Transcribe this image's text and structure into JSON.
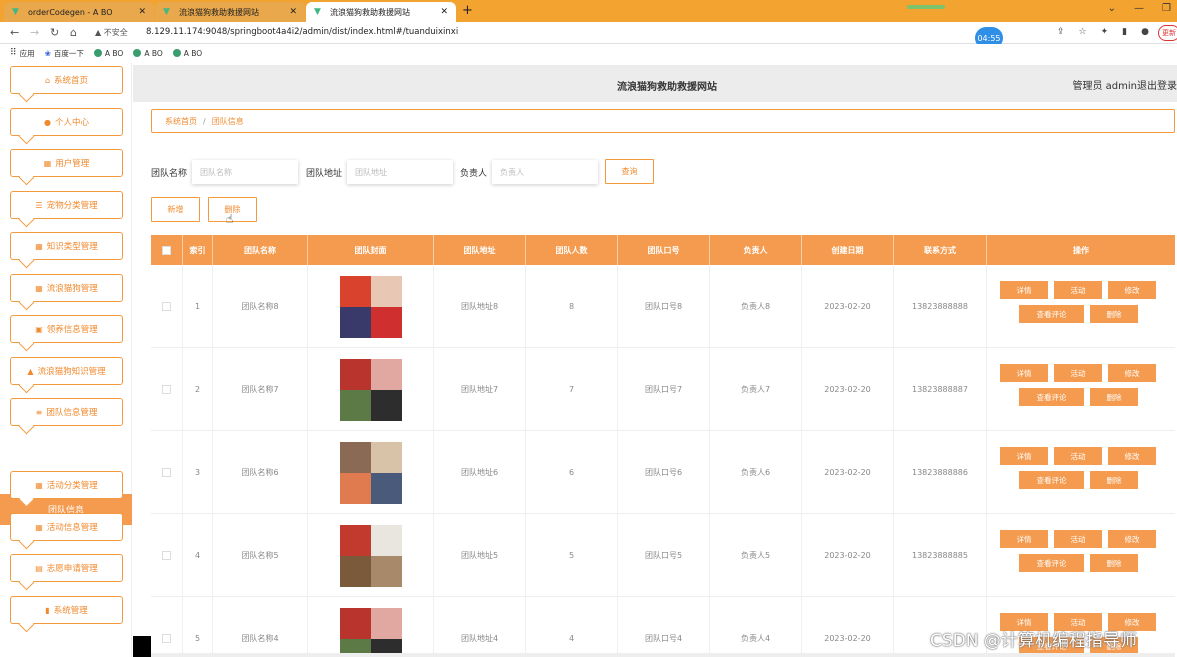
{
  "browser": {
    "tabs": [
      {
        "title": "orderCodegen - A BO"
      },
      {
        "title": "流浪猫狗救助救援网站"
      },
      {
        "title": "流浪猫狗救助救援网站"
      }
    ],
    "address": {
      "security": "不安全",
      "url": "8.129.11.174:9048/springboot4a4i2/admin/dist/index.html#/tuanduixinxi"
    },
    "timer": "04:55",
    "update_label": "更新",
    "bookmarks": [
      {
        "label": "应用",
        "icon": "apps-icon"
      },
      {
        "label": "百度一下",
        "icon": "baidu-icon"
      },
      {
        "label": "A BO",
        "icon": "site-icon"
      },
      {
        "label": "A BO",
        "icon": "site-icon"
      },
      {
        "label": "A BO",
        "icon": "site-icon"
      }
    ]
  },
  "header": {
    "site_name": "流浪猫狗救助救援网站",
    "admin": "管理员 admin",
    "logout": "退出登录"
  },
  "sidebar": {
    "items": [
      {
        "label": "系统首页",
        "icon": "home-icon"
      },
      {
        "label": "个人中心",
        "icon": "user-icon"
      },
      {
        "label": "用户管理",
        "icon": "grid-icon"
      },
      {
        "label": "宠物分类管理",
        "icon": "list-icon"
      },
      {
        "label": "知识类型管理",
        "icon": "grid-icon"
      },
      {
        "label": "流浪猫狗管理",
        "icon": "grid-icon"
      },
      {
        "label": "领养信息管理",
        "icon": "ticket-icon"
      },
      {
        "label": "流浪猫狗知识管理",
        "icon": "thumb-icon"
      },
      {
        "label": "团队信息管理",
        "icon": "sliders-icon"
      },
      {
        "label": "活动分类管理",
        "icon": "grid-icon"
      },
      {
        "label": "活动信息管理",
        "icon": "grid-icon"
      },
      {
        "label": "志愿申请管理",
        "icon": "calendar-icon"
      },
      {
        "label": "系统管理",
        "icon": "chart-icon"
      }
    ],
    "active_sub": "团队信息"
  },
  "breadcrumb": {
    "home": "系统首页",
    "sep": "/",
    "current": "团队信息"
  },
  "search": {
    "name_label": "团队名称",
    "name_placeholder": "团队名称",
    "addr_label": "团队地址",
    "addr_placeholder": "团队地址",
    "owner_label": "负责人",
    "owner_placeholder": "负责人",
    "query": "查询"
  },
  "actions": {
    "add": "新增",
    "delete": "删除"
  },
  "table": {
    "columns": [
      "索引",
      "团队名称",
      "团队封面",
      "团队地址",
      "团队人数",
      "团队口号",
      "负责人",
      "创建日期",
      "联系方式",
      "操作"
    ],
    "row_buttons": {
      "detail": "详情",
      "activity": "活动",
      "edit": "修改",
      "comments": "查看评论",
      "delete": "删除"
    },
    "rows": [
      {
        "idx": "1",
        "name": "团队名称8",
        "addr": "团队地址8",
        "count": "8",
        "slogan": "团队口号8",
        "owner": "负责人8",
        "date": "2023-02-20",
        "phone": "13823888888"
      },
      {
        "idx": "2",
        "name": "团队名称7",
        "addr": "团队地址7",
        "count": "7",
        "slogan": "团队口号7",
        "owner": "负责人7",
        "date": "2023-02-20",
        "phone": "13823888887"
      },
      {
        "idx": "3",
        "name": "团队名称6",
        "addr": "团队地址6",
        "count": "6",
        "slogan": "团队口号6",
        "owner": "负责人6",
        "date": "2023-02-20",
        "phone": "13823888886"
      },
      {
        "idx": "4",
        "name": "团队名称5",
        "addr": "团队地址5",
        "count": "5",
        "slogan": "团队口号5",
        "owner": "负责人5",
        "date": "2023-02-20",
        "phone": "13823888885"
      },
      {
        "idx": "5",
        "name": "团队名称4",
        "addr": "团队地址4",
        "count": "4",
        "slogan": "团队口号4",
        "owner": "负责人4",
        "date": "2023-02-20",
        "phone": ""
      }
    ]
  },
  "watermark": "CSDN @计算机编程指导师",
  "colors": {
    "accent": "#f49b4f",
    "chrome": "#f2a330"
  }
}
